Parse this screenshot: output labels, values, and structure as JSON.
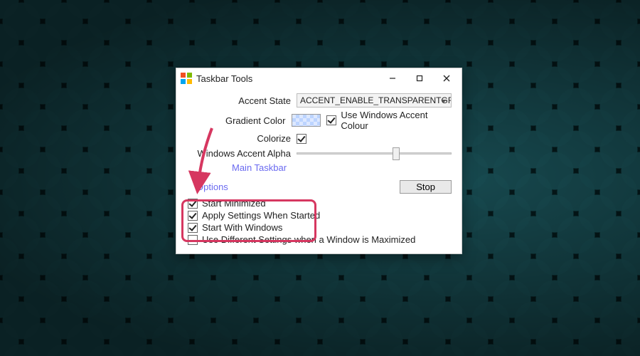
{
  "window": {
    "title": "Taskbar Tools",
    "labels": {
      "accent_state": "Accent State",
      "gradient_color": "Gradient Color",
      "colorize": "Colorize",
      "windows_accent_alpha": "Windows Accent Alpha",
      "use_windows_accent_colour": "Use Windows Accent Colour"
    },
    "accent_state_value": "ACCENT_ENABLE_TRANSPARENTGRADI",
    "links": {
      "main_taskbar": "Main Taskbar",
      "options": "Options"
    },
    "buttons": {
      "stop": "Stop"
    },
    "options": {
      "start_minimized": "Start Minimized",
      "apply_settings_when_started": "Apply Settings When Started",
      "start_with_windows": "Start With Windows",
      "use_different_settings_maximized": "Use Different Settings when a Window is Maximized"
    },
    "checked": {
      "use_windows_accent_colour": true,
      "colorize": true,
      "start_minimized": true,
      "apply_settings_when_started": true,
      "start_with_windows": true,
      "use_different_settings_maximized": false
    }
  },
  "annotation": {
    "highlight_color": "#d63760",
    "arrow_color": "#d63760"
  }
}
